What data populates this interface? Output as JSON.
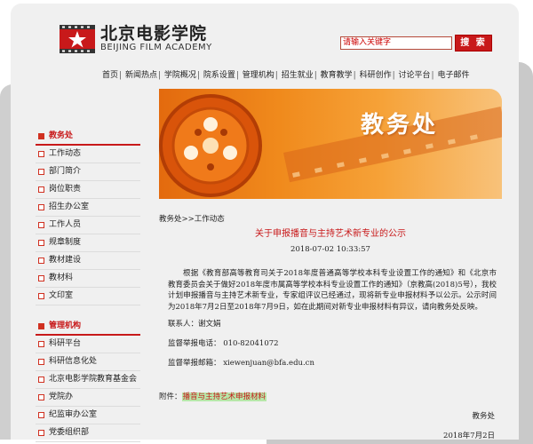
{
  "header": {
    "logo_cn": "北京电影学院",
    "logo_en": "BEIJING FILM ACADEMY",
    "search_placeholder": "请输入关键字",
    "search_button": "搜 索"
  },
  "topnav": [
    "首页",
    "新闻热点",
    "学院概况",
    "院系设置",
    "管理机构",
    "招生就业",
    "教育教学",
    "科研创作",
    "讨论平台",
    "电子邮件"
  ],
  "banner": {
    "title": "教务处"
  },
  "sidebar": {
    "section1": {
      "title": "教务处",
      "items": [
        "工作动态",
        "部门简介",
        "岗位职责",
        "招生办公室",
        "工作人员",
        "规章制度",
        "教材建设",
        "教材科",
        "文印室"
      ]
    },
    "section2": {
      "title": "管理机构",
      "items": [
        "科研平台",
        "科研信息化处",
        "北京电影学院教育基金会",
        "党院办",
        "纪监审办公室",
        "党委组织部"
      ]
    }
  },
  "article": {
    "breadcrumb": "教务处>>工作动态",
    "title": "关于申报播音与主持艺术新专业的公示",
    "date": "2018-07-02 10:33:57",
    "body": "根据《教育部高等教育司关于2018年度普通高等学校本科专业设置工作的通知》和《北京市教育委员会关于做好2018年度市属高等学校本科专业设置工作的通知》（京教高(2018)5号），我校计划申报播音与主持艺术新专业，专家组评议已经通过，现将新专业申报材料予以公示。公示时间为2018年7月2日至2018年7月9日，如在此期间对新专业申报材料有异议，请向教务处反映。",
    "contact": "联系人：谢文娟",
    "phone": "监督举报电话：  010-82041072",
    "email": "监督举报邮箱：  xiewenjuan@bfa.edu.cn",
    "attach_label": "附件：",
    "attach_link": "播音与主持艺术申报材料",
    "signature": "教务处",
    "sign_date": "2018年7月2日"
  },
  "colors": {
    "accent": "#c8191a",
    "banner": "#f08a1c",
    "background": "#f0f0f0"
  }
}
